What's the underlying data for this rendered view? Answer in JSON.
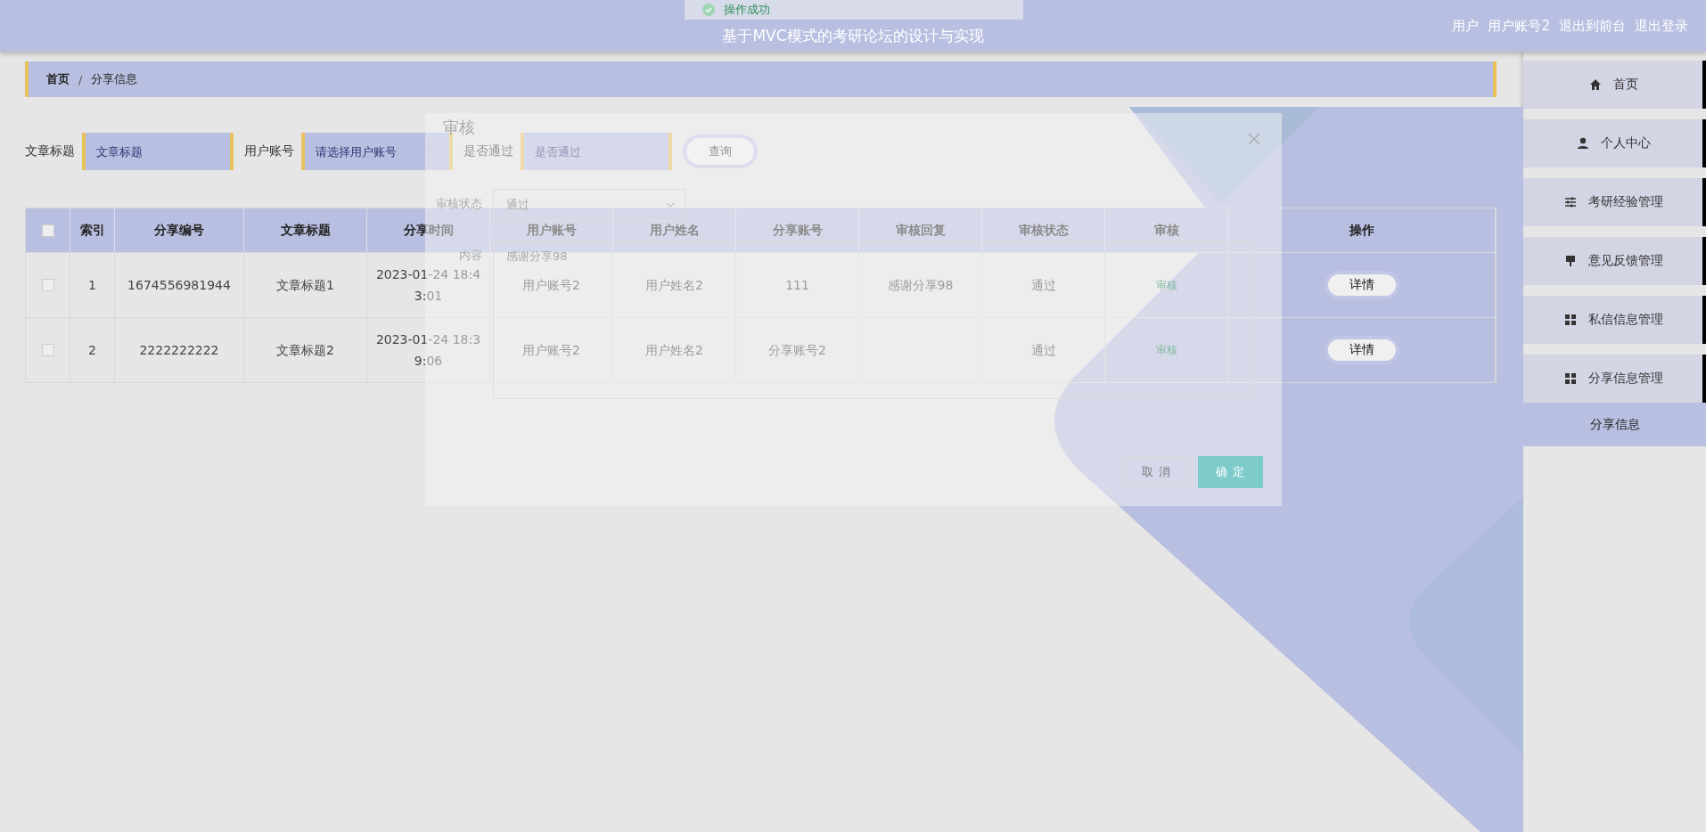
{
  "header": {
    "title": "基于MVC模式的考研论坛的设计与实现",
    "toast": "操作成功",
    "user_label": "用户",
    "user_account": "用户账号2",
    "links": [
      "退出到前台",
      "退出登录"
    ]
  },
  "breadcrumb": {
    "items": [
      "首页",
      "分享信息"
    ],
    "separator": "/"
  },
  "search": {
    "fields": [
      {
        "label": "文章标题",
        "placeholder": "文章标题",
        "kind": "input"
      },
      {
        "label": "用户账号",
        "placeholder": "请选择用户账号",
        "kind": "select"
      },
      {
        "label": "是否通过",
        "placeholder": "是否通过",
        "kind": "select"
      }
    ],
    "button": "查询"
  },
  "table": {
    "select_all": {
      "checked": false
    },
    "columns": [
      "索引",
      "分享编号",
      "文章标题",
      "分享时间",
      "用户账号",
      "用户姓名",
      "分享账号",
      "审核回复",
      "审核状态",
      "审核",
      "操作"
    ],
    "rows": [
      {
        "selected": false,
        "index": "1",
        "share_id": "1674556981944",
        "title": "文章标题1",
        "time": "2023-01-24 18:43:01",
        "account": "用户账号2",
        "name": "用户姓名2",
        "share_account": "111",
        "reply": "感谢分享98",
        "status": "通过",
        "review": "审核",
        "action": "详情"
      },
      {
        "selected": false,
        "index": "2",
        "share_id": "2222222222",
        "title": "文章标题2",
        "time": "2023-01-24 18:39:06",
        "account": "用户账号2",
        "name": "用户姓名2",
        "share_account": "分享账号2",
        "status": "通过",
        "review": "审核",
        "action": "详情"
      }
    ]
  },
  "dialog": {
    "title": "审核",
    "fields": [
      {
        "label": "审核状态",
        "value": "通过",
        "kind": "select"
      },
      {
        "label": "内容",
        "value": "感谢分享98",
        "kind": "textarea"
      }
    ],
    "buttons": [
      {
        "label": "取 消",
        "kind": "default"
      },
      {
        "label": "确 定",
        "kind": "primary"
      }
    ]
  },
  "sidebar": {
    "items": [
      {
        "label": "首页",
        "selected": false
      },
      {
        "label": "个人中心",
        "selected": false
      },
      {
        "label": "考研经验管理",
        "selected": false
      },
      {
        "label": "意见反馈管理",
        "selected": false
      },
      {
        "label": "私信信息管理",
        "selected": false
      },
      {
        "label": "分享信息管理",
        "selected": false,
        "children": [
          {
            "label": "分享信息",
            "selected": true
          }
        ]
      }
    ]
  }
}
